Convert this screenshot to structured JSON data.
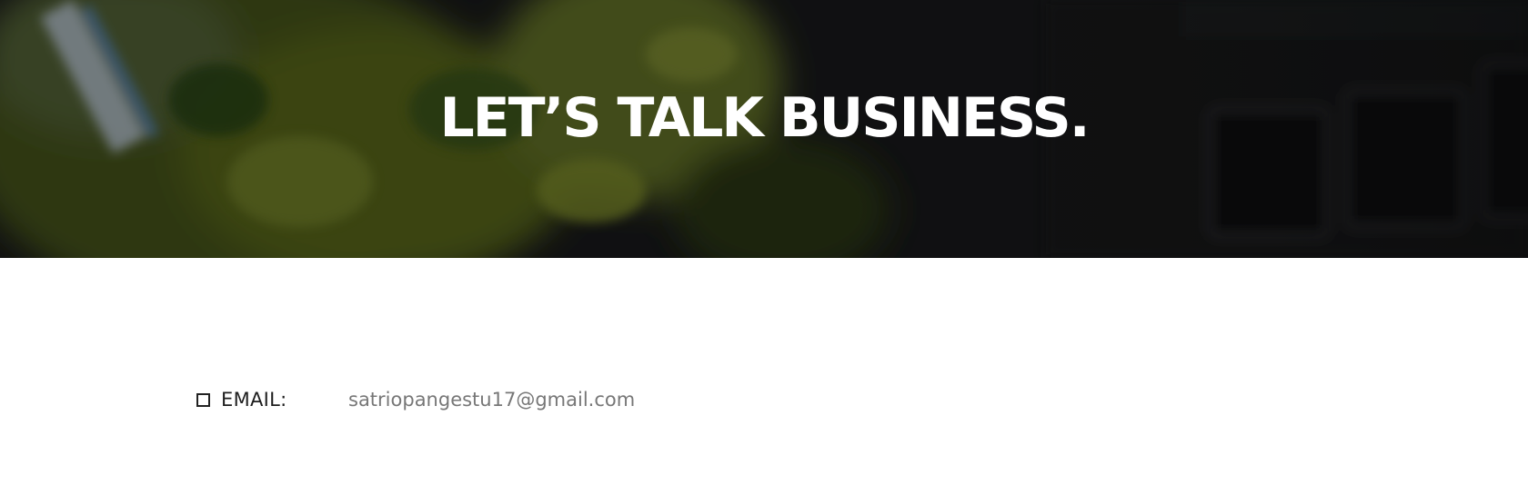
{
  "hero": {
    "title": "LET’S TALK BUSINESS.",
    "background_image": "blurred-drink-and-keyboard-photo"
  },
  "contact": {
    "icon": "checkbox-icon",
    "email_label": "EMAIL:",
    "email_value": "satriopangestu17@gmail.com"
  },
  "colors": {
    "hero_overlay": "#17181a",
    "title": "#ffffff",
    "label": "#1e1e1e",
    "value": "#777777",
    "page_background": "#ffffff"
  }
}
